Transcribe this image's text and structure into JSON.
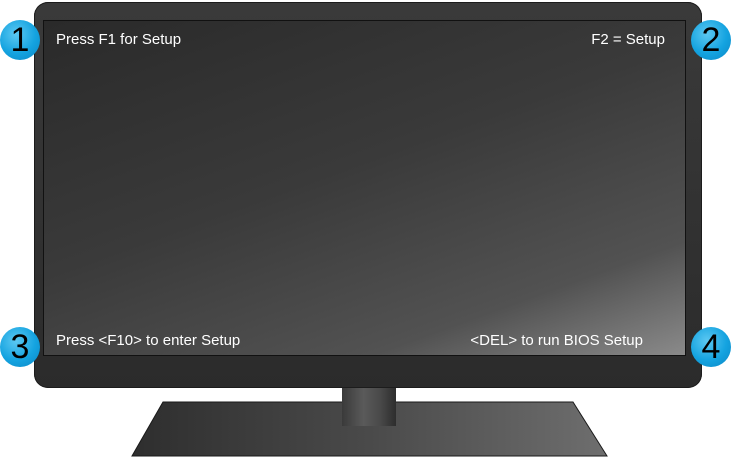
{
  "screen": {
    "top_left": "Press F1 for Setup",
    "top_right": "F2 = Setup",
    "bottom_left": "Press <F10> to enter Setup",
    "bottom_right": "<DEL> to run BIOS Setup"
  },
  "callouts": [
    "1",
    "2",
    "3",
    "4"
  ],
  "colors": {
    "callout": "#14a3e0",
    "bezel": "#2e2e2e",
    "screen_text": "#ffffff"
  }
}
